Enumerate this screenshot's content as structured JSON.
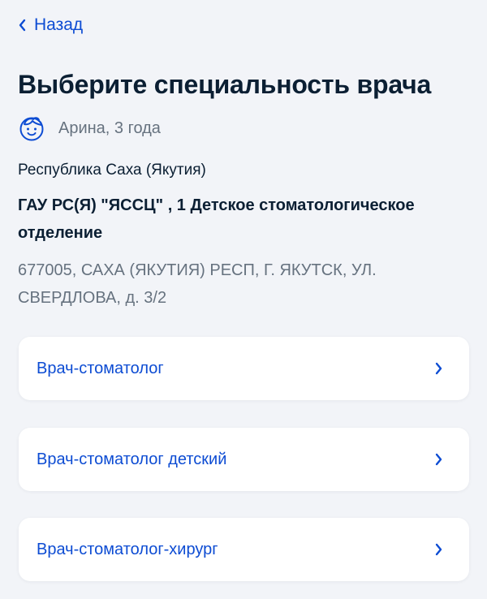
{
  "nav": {
    "back_label": "Назад"
  },
  "page": {
    "title": "Выберите специальность врача"
  },
  "patient": {
    "name": "Арина, 3 года",
    "avatar_icon": "child-face-icon"
  },
  "clinic": {
    "region": "Республика Саха (Якутия)",
    "organization": "ГАУ РС(Я) \"ЯССЦ\" , 1 Детское стоматологическое отделение",
    "address": "677005, САХА (ЯКУТИЯ) РЕСП, Г. ЯКУТСК, УЛ. СВЕРДЛОВА, д. 3/2"
  },
  "specialties": [
    {
      "label": "Врач-стоматолог"
    },
    {
      "label": "Врач-стоматолог детский"
    },
    {
      "label": "Врач-стоматолог-хирург"
    }
  ],
  "colors": {
    "accent": "#0d4cd3",
    "text": "#0b1f33",
    "secondary_text": "#66727f",
    "background": "#f2f4f8",
    "card": "#ffffff"
  }
}
